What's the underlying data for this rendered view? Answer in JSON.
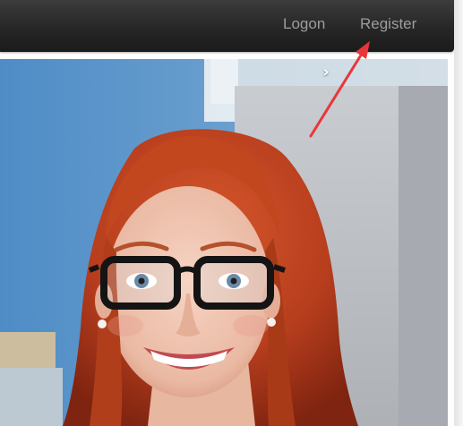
{
  "navbar": {
    "links": [
      {
        "label": "Logon"
      },
      {
        "label": "Register"
      }
    ]
  },
  "carousel": {
    "next_control": "›",
    "image_description_icon": "photo-of-woman-with-red-hair-and-glasses"
  },
  "colors": {
    "navbar_bg": "#222222",
    "nav_link_text": "#9d9d9d",
    "annotation_arrow": "#e8373b"
  }
}
